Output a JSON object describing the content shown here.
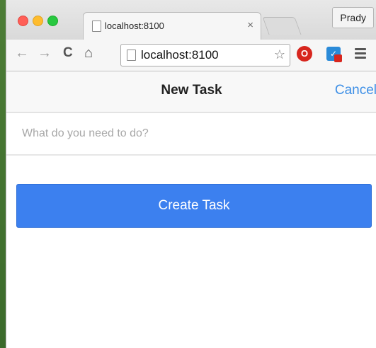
{
  "browser": {
    "tab_title": "localhost:8100",
    "tab_close": "×",
    "profile_name": "Prady",
    "url": "localhost:8100",
    "back_glyph": "←",
    "forward_glyph": "→",
    "reload_glyph": "C",
    "home_glyph": "⌂",
    "star_glyph": "☆",
    "icons": {
      "back": "back-arrow-icon",
      "forward": "forward-arrow-icon",
      "reload": "reload-icon",
      "home": "home-icon",
      "bookmark": "star-icon",
      "extension1": "red-circle-extension-icon",
      "extension2": "blue-check-extension-icon",
      "menu": "hamburger-menu-icon"
    }
  },
  "header": {
    "title": "New Task",
    "cancel_label": "Cancel"
  },
  "form": {
    "task_placeholder": "What do you need to do?",
    "task_value": "",
    "create_label": "Create Task"
  },
  "colors": {
    "accent": "#3c80ef",
    "link": "#3d8fe6"
  }
}
